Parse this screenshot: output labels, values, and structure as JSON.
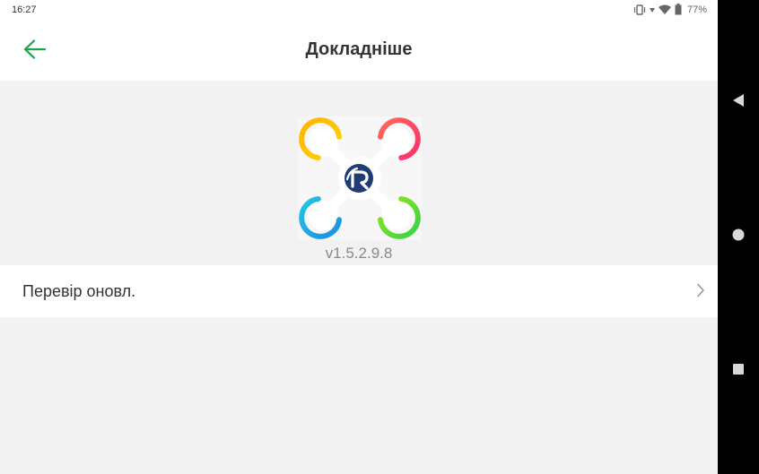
{
  "status_bar": {
    "time": "16:27",
    "battery_percent": "77%"
  },
  "header": {
    "title": "Докладніше",
    "back_icon": "arrow-left-icon",
    "accent_color": "#1aa34a"
  },
  "about": {
    "logo_icon": "drone-app-logo",
    "version": "v1.5.2.9.8"
  },
  "list": {
    "items": [
      {
        "label": "Перевір оновл.",
        "icon": "chevron-right-icon"
      }
    ]
  },
  "nav_bar": {
    "buttons": [
      "back-triangle-icon",
      "home-circle-icon",
      "recents-square-icon"
    ]
  },
  "colors": {
    "background": "#f2f2f2",
    "surface": "#ffffff",
    "text_primary": "#333333",
    "text_secondary": "#8a8a8a"
  }
}
